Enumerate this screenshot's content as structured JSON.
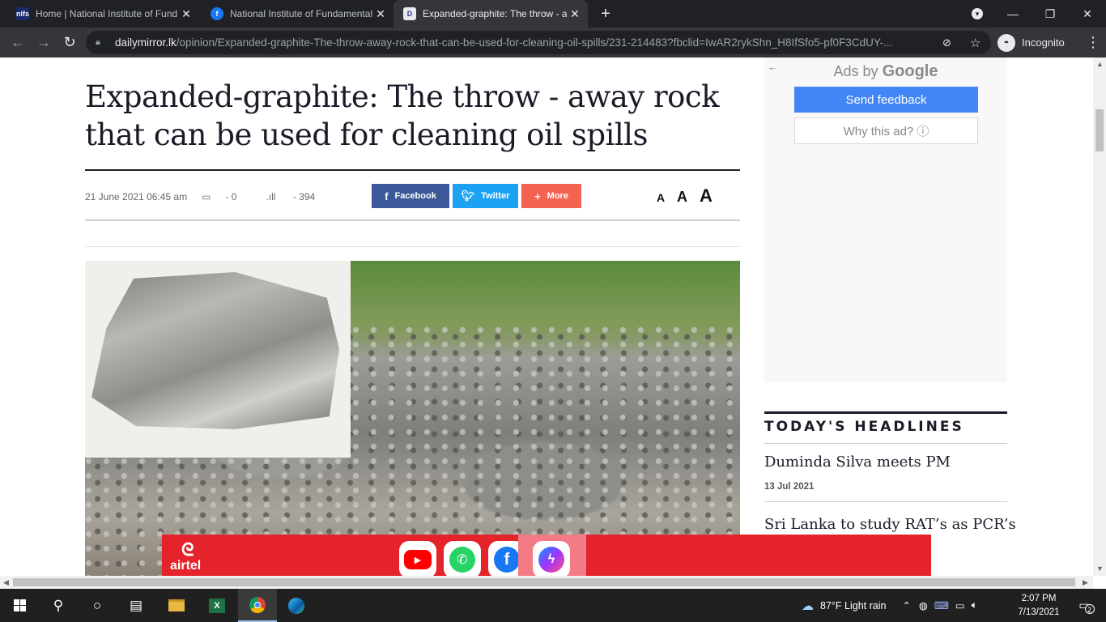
{
  "browser": {
    "tabs": [
      {
        "title": "Home | National Institute of Fund",
        "favicon_color": "#1b2a6b",
        "favicon_text": "nifs"
      },
      {
        "title": "National Institute of Fundamental",
        "favicon_color": "#1877f2",
        "favicon_text": "f"
      },
      {
        "title": "Expanded-graphite: The throw - away",
        "favicon_color": "#2a3f8f",
        "favicon_text": "D"
      }
    ],
    "url_domain": "dailymirror.lk",
    "url_path": "/opinion/Expanded-graphite-The-throw-away-rock-that-can-be-used-for-cleaning-oil-spills/231-214483?fbclid=IwAR2rykShn_H8IfSfo5-pf0F3CdUY-...",
    "incognito_label": "Incognito"
  },
  "article": {
    "headline": "Expanded-graphite: The throw - away rock that can be used for cleaning oil spills",
    "date": "21 June 2021 06:45 am",
    "comments": "- 0",
    "views": "- 394",
    "share_facebook": "Facebook",
    "share_twitter": "Twitter",
    "share_more": "More",
    "font_sizes": [
      "A",
      "A",
      "A"
    ]
  },
  "ad": {
    "ads_by": "Ads by",
    "google": "Google",
    "send_feedback": "Send feedback",
    "why_this_ad": "Why this ad? ⓘ"
  },
  "headlines": {
    "title": "TODAY'S HEADLINES",
    "items": [
      {
        "title": "Duminda Silva meets PM",
        "date": "13 Jul 2021"
      },
      {
        "title": "Sri Lanka to study RAT’s as PCR’s",
        "date": ""
      }
    ]
  },
  "banner": {
    "brand": "airtel"
  },
  "taskbar": {
    "weather": "87°F  Light rain",
    "time": "2:07 PM",
    "date": "7/13/2021",
    "notifications": "2"
  },
  "colors": {
    "facebook": "#3b5998",
    "twitter": "#1da1f2",
    "more": "#f4634f",
    "airtel_red": "#e4232b",
    "google_blue": "#4285f4"
  }
}
